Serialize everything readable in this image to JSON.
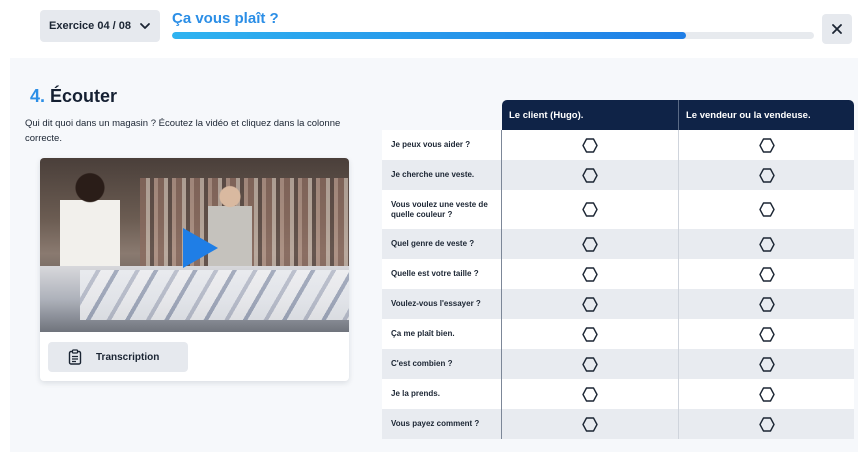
{
  "header": {
    "exercise_label": "Exercice 04 / 08",
    "title": "Ça vous plaît ?",
    "progress_fraction": 0.8
  },
  "icons": {
    "dropdown": "chevron-down-icon",
    "close": "close-icon",
    "play": "play-icon",
    "transcription": "clipboard-icon",
    "option": "hexagon-radio-icon"
  },
  "colors": {
    "accent": "#2b8ee6",
    "table_header": "#0f2347",
    "button_bg": "#e6e9ee"
  },
  "section": {
    "number": "4.",
    "title": "Écouter",
    "instruction": "Qui dit quoi dans un magasin ? Écoutez la vidéo et cliquez dans la colonne correcte."
  },
  "video": {
    "transcription_label": "Transcription"
  },
  "grid": {
    "columns": [
      "Le client (Hugo).",
      "Le vendeur ou la vendeuse."
    ],
    "rows": [
      "Je peux vous aider ?",
      "Je cherche une veste.",
      "Vous voulez une veste de quelle couleur ?",
      "Quel genre de veste ?",
      "Quelle est votre taille ?",
      "Voulez-vous l'essayer ?",
      "Ça me plaît bien.",
      "C'est combien ?",
      "Je la prends.",
      "Vous payez comment ?"
    ]
  }
}
